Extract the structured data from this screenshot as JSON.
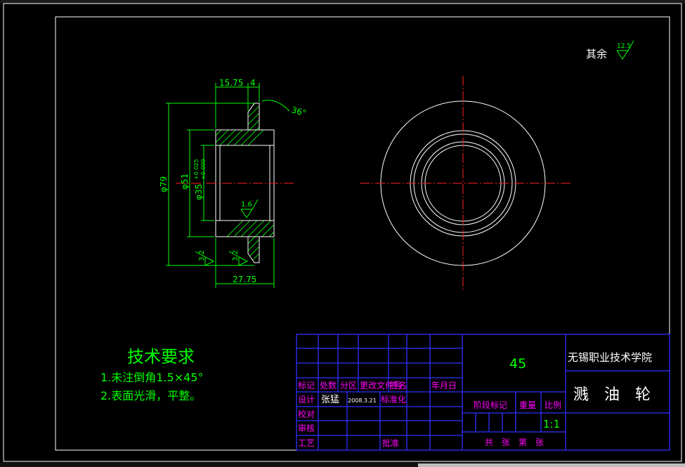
{
  "drawing": {
    "surface_note_prefix": "其余",
    "surface_note_value": "12.5",
    "dims": {
      "d1": "15.75",
      "d2": "4",
      "angle": "36°",
      "phi79": "φ79",
      "phi51": "φ51",
      "phi35": "φ35",
      "tol_plus": "+0.025",
      "tol_minus": "+0.009",
      "rough_16": "1.6",
      "rough_32a": "3.2",
      "rough_32b": "3.2",
      "width": "27.75"
    }
  },
  "requirements": {
    "title": "技术要求",
    "items": [
      "1.未注倒角1.5×45°",
      "2.表面光滑，平整。"
    ]
  },
  "title_block": {
    "rev_headers": [
      "标记",
      "处数",
      "分区",
      "更改文件号",
      "签名",
      "年月日"
    ],
    "row_design": "设计",
    "designer": "张猛",
    "date": "2008.3.21",
    "standardize": "标准化",
    "row_check": "校对",
    "row_review": "审核",
    "row_process": "工艺",
    "approve": "批准",
    "material": "45",
    "stage_mark": "阶段标记",
    "weight": "重量",
    "scale_label": "比例",
    "scale": "1:1",
    "sheets": "共　张　第　张",
    "school": "无锡职业技术学院",
    "part_name": "溅　油　轮"
  },
  "colors": {
    "background": "#000000",
    "outline": "#ffffff",
    "dimension": "#00ff00",
    "centerline": "#ff2020",
    "table_grid": "#3030ff",
    "table_label": "#ff00ff"
  }
}
